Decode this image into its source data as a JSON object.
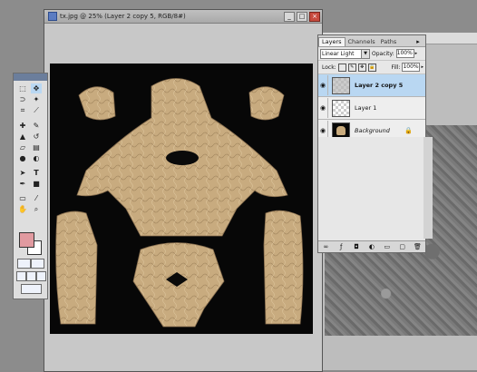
{
  "document": {
    "title": "tx.jpg @ 25% (Layer 2 copy 5, RGB/8#)",
    "minimize": "_",
    "maximize": "□",
    "close": "×"
  },
  "toolbox": {
    "tools": [
      "marquee-icon",
      "move-icon",
      "lasso-icon",
      "magic-wand-icon",
      "crop-icon",
      "slice-icon",
      "healing-icon",
      "brush-icon",
      "stamp-icon",
      "history-brush-icon",
      "eraser-icon",
      "gradient-icon",
      "blur-icon",
      "dodge-icon",
      "path-select-icon",
      "type-icon",
      "pen-icon",
      "shape-icon",
      "notes-icon",
      "eyedropper-icon",
      "hand-icon",
      "zoom-icon"
    ],
    "foreground_color": "#e19aa0",
    "background_color": "#ffffff"
  },
  "layers_panel": {
    "tabs": [
      "Layers",
      "Channels",
      "Paths"
    ],
    "active_tab": "Layers",
    "blend_mode": "Linear Light",
    "opacity_label": "Opacity:",
    "opacity": "100%",
    "lock_label": "Lock:",
    "fill_label": "Fill:",
    "fill": "100%",
    "layers": [
      {
        "name": "Layer 2 copy 5",
        "selected": true
      },
      {
        "name": "Layer 1",
        "selected": false
      },
      {
        "name": "Background",
        "selected": false
      }
    ]
  },
  "colors": {
    "texture": "#c6a97c",
    "selected_layer": "#b9d7f2",
    "workspace": "#8c8c8c"
  }
}
